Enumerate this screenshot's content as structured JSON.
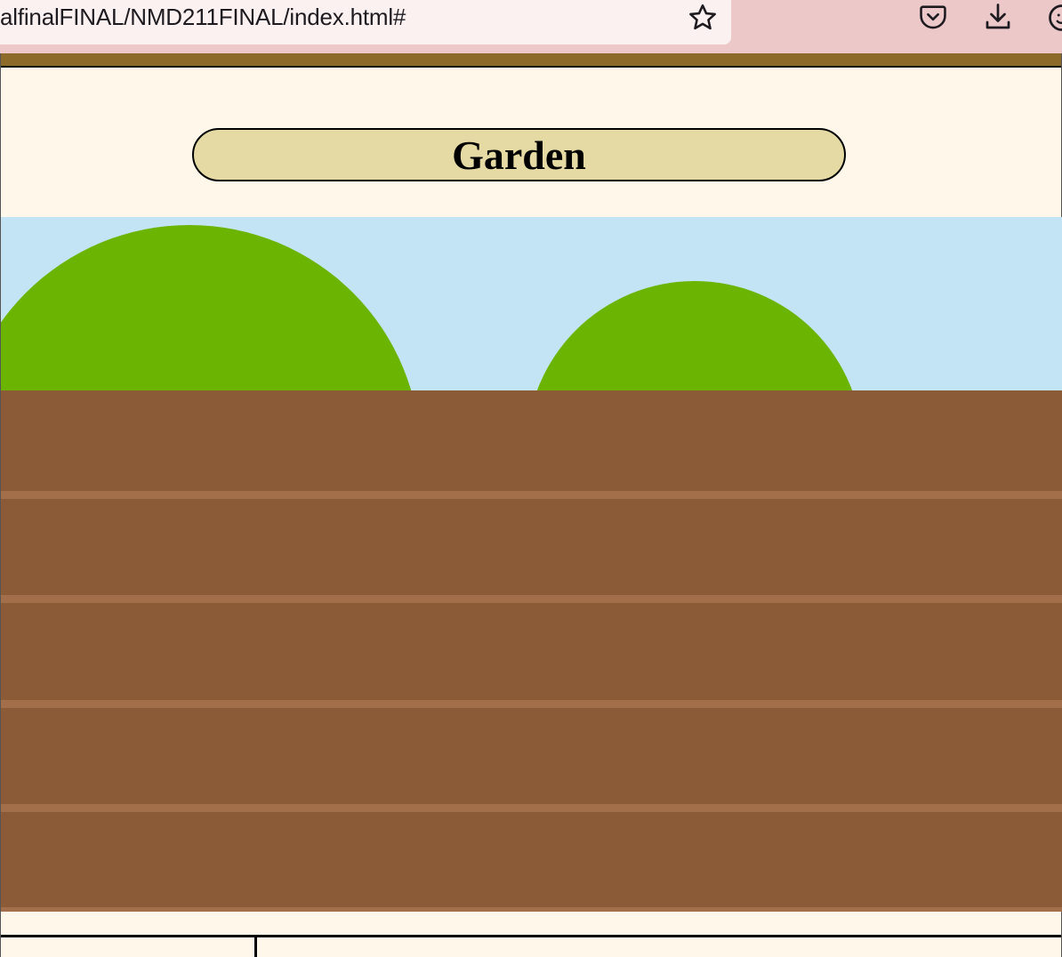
{
  "browser": {
    "url": "alfinalFINAL/NMD211FINAL/index.html#",
    "toolbar_icons": [
      "star-icon",
      "pocket-icon",
      "download-icon",
      "account-icon"
    ]
  },
  "page": {
    "title": "Garden"
  },
  "colors": {
    "chrome": "#ecc8c9",
    "url_field": "#fbf1f1",
    "page_background": "#fff8ea",
    "top_band": "#8b6a2a",
    "title_pill": "#e5daa3",
    "sky": "#c3e4f4",
    "bush": "#6bb401",
    "soil": "#8b5a36",
    "soil_line": "#a36e4a"
  }
}
